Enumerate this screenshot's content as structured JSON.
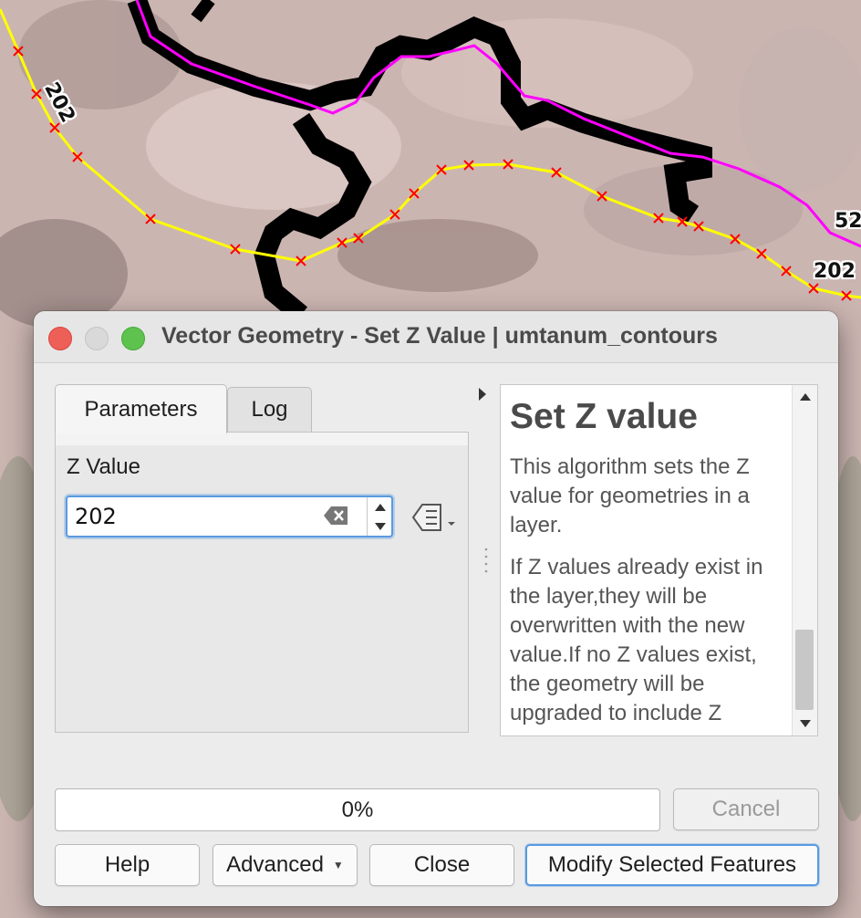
{
  "map": {
    "labels": [
      "202",
      "52",
      "202"
    ],
    "colors": {
      "contour_line": "#ffff00",
      "vertex_marker": "#ff0000",
      "boundary_line": "#ff00ff",
      "mask_outline": "#000000"
    }
  },
  "dialog": {
    "title": "Vector Geometry - Set Z Value | umtanum_contours",
    "tabs": [
      "Parameters",
      "Log"
    ],
    "parameters": {
      "z_label": "Z Value",
      "z_value": "202"
    },
    "help": {
      "title": "Set Z value",
      "paragraph1": "This algorithm sets the Z value for geometries in a layer.",
      "paragraph2": "If Z values already exist in the layer,they will be overwritten with the new value.If no Z values exist, the geometry will be upgraded to include Z"
    },
    "progress": "0%",
    "buttons": {
      "cancel": "Cancel",
      "help": "Help",
      "advanced": "Advanced",
      "close": "Close",
      "run": "Modify Selected Features"
    },
    "icons": {
      "clear": "clear-text-icon",
      "spin_up": "spin-up-icon",
      "spin_down": "spin-down-icon",
      "data_defined": "data-defined-override-icon",
      "splitter": "collapse-arrow-icon"
    }
  }
}
